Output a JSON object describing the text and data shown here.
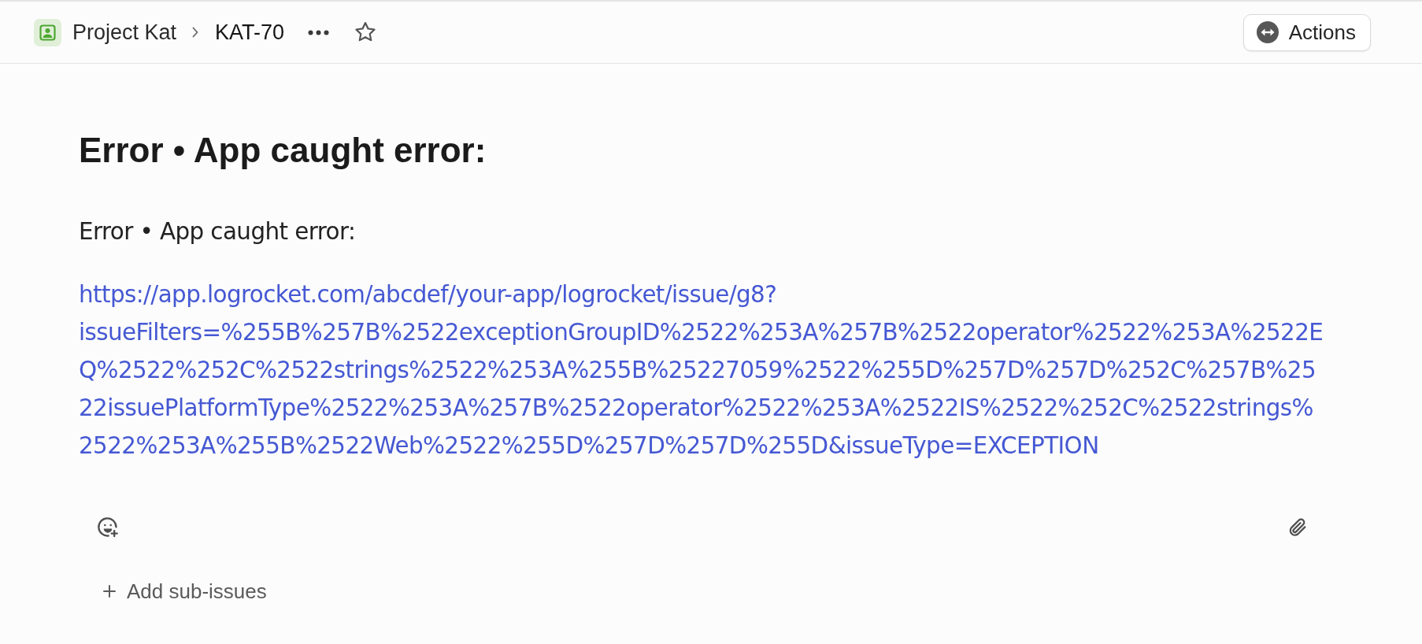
{
  "header": {
    "breadcrumbs": [
      {
        "kind": "project",
        "label": "Project Kat"
      },
      {
        "kind": "issue",
        "label": "KAT-70"
      }
    ],
    "starred": false,
    "actions_button": {
      "label": "Actions"
    }
  },
  "issue": {
    "title": "Error • App caught error:",
    "description": [
      {
        "kind": "paragraph",
        "text": "Error • App caught error:"
      },
      {
        "kind": "link",
        "text": "https://app.logrocket.com/abcdef/your-app/logrocket/issue/g8?issueFilters=%255B%257B%2522exceptionGroupID%2522%253A%257B%2522operator%2522%253A%2522EQ%2522%252C%2522strings%2522%253A%255B%25227059%2522%255D%257D%257D%252C%257B%2522issuePlatformType%2522%253A%257B%2522operator%2522%253A%2522IS%2522%252C%2522strings%2522%253A%255B%2522Web%2522%255D%257D%257D%255D&issueType=EXCEPTION"
      }
    ]
  },
  "sub_issues": {
    "label": "Add sub-issues"
  }
}
